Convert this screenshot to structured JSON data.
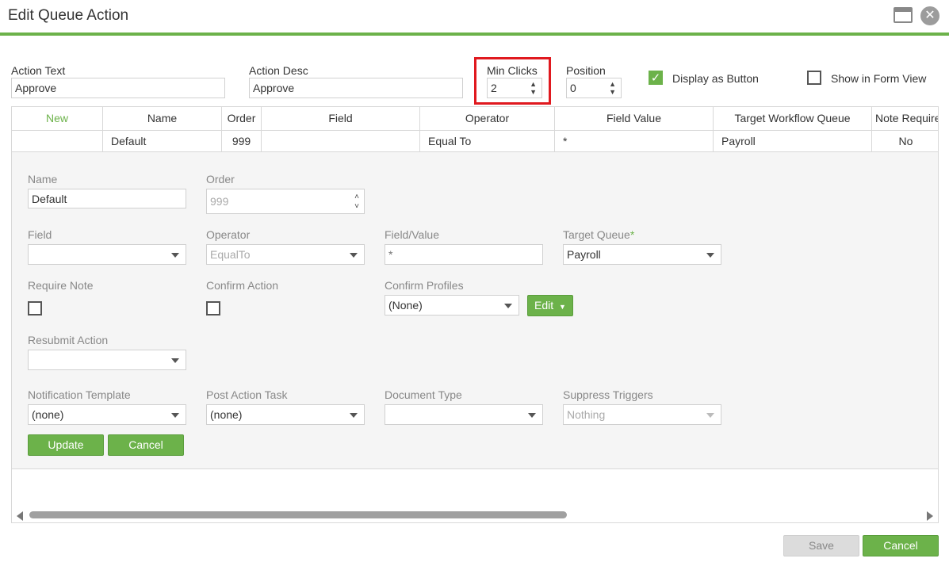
{
  "window": {
    "title": "Edit Queue Action"
  },
  "top_form": {
    "action_text": {
      "label": "Action Text",
      "value": "Approve"
    },
    "action_desc": {
      "label": "Action Desc",
      "value": "Approve"
    },
    "min_clicks": {
      "label": "Min Clicks",
      "value": "2"
    },
    "position": {
      "label": "Position",
      "value": "0"
    },
    "display_as_button": {
      "label": "Display as Button",
      "checked": true
    },
    "show_in_form_view": {
      "label": "Show in Form View",
      "checked": false
    }
  },
  "grid": {
    "columns": [
      "New",
      "Name",
      "Order",
      "Field",
      "Operator",
      "Field Value",
      "Target Workflow Queue",
      "Note Require"
    ],
    "rows": [
      {
        "new": "",
        "name": "Default",
        "order": "999",
        "field": "",
        "operator": "Equal To",
        "field_value": "*",
        "target_queue": "Payroll",
        "note_required": "No"
      }
    ]
  },
  "detail": {
    "name": {
      "label": "Name",
      "value": "Default"
    },
    "order": {
      "label": "Order",
      "value": "999"
    },
    "field": {
      "label": "Field",
      "value": ""
    },
    "operator": {
      "label": "Operator",
      "value": "EqualTo"
    },
    "field_value": {
      "label": "Field/Value",
      "placeholder": "*"
    },
    "target_queue": {
      "label": "Target Queue",
      "required_mark": "*",
      "value": "Payroll"
    },
    "require_note": {
      "label": "Require Note"
    },
    "confirm_action": {
      "label": "Confirm Action"
    },
    "confirm_profiles": {
      "label": "Confirm Profiles",
      "value": "(None)"
    },
    "edit_button": {
      "label": "Edit"
    },
    "resubmit_action": {
      "label": "Resubmit Action",
      "value": ""
    },
    "notification_template": {
      "label": "Notification Template",
      "value": "(none)"
    },
    "post_action_task": {
      "label": "Post Action Task",
      "value": "(none)"
    },
    "document_type": {
      "label": "Document Type",
      "value": ""
    },
    "suppress_triggers": {
      "label": "Suppress Triggers",
      "value": "Nothing"
    },
    "update_button": {
      "label": "Update"
    },
    "cancel_button": {
      "label": "Cancel"
    }
  },
  "footer": {
    "save_label": "Save",
    "cancel_label": "Cancel"
  },
  "colors": {
    "accent_green": "#6cb24a",
    "highlight_red": "#e0191f"
  }
}
